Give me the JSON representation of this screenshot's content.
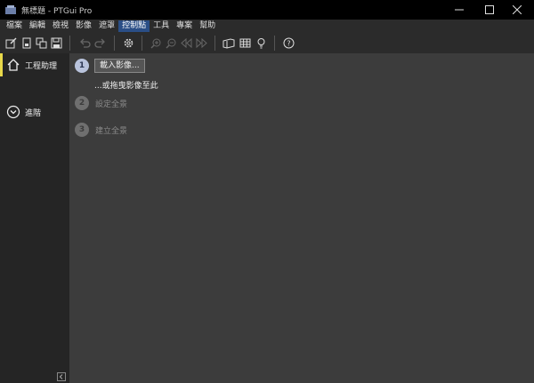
{
  "window": {
    "title": "無標題 - PTGui Pro"
  },
  "menu": [
    "檔案",
    "編輯",
    "檢視",
    "影像",
    "遮罩",
    "控制點",
    "工具",
    "專案",
    "幫助"
  ],
  "menu_active_index": 5,
  "sidebar": {
    "items": [
      {
        "label": "工程助理",
        "icon": "home-icon",
        "active": true
      },
      {
        "label": "進階",
        "icon": "chevron-down-circle-icon",
        "active": false
      }
    ]
  },
  "wizard": {
    "steps": [
      {
        "number": "1",
        "label": "載入影像...",
        "enabled": true
      },
      {
        "number": "2",
        "label": "設定全景",
        "enabled": false
      },
      {
        "number": "3",
        "label": "建立全景",
        "enabled": false
      }
    ],
    "drag_hint": "...或拖曳影像至此"
  },
  "colors": {
    "accent": "#e8d84a",
    "menu_highlight": "#2a4e86",
    "background": "#3c3c3c",
    "sidebar": "#252525"
  }
}
